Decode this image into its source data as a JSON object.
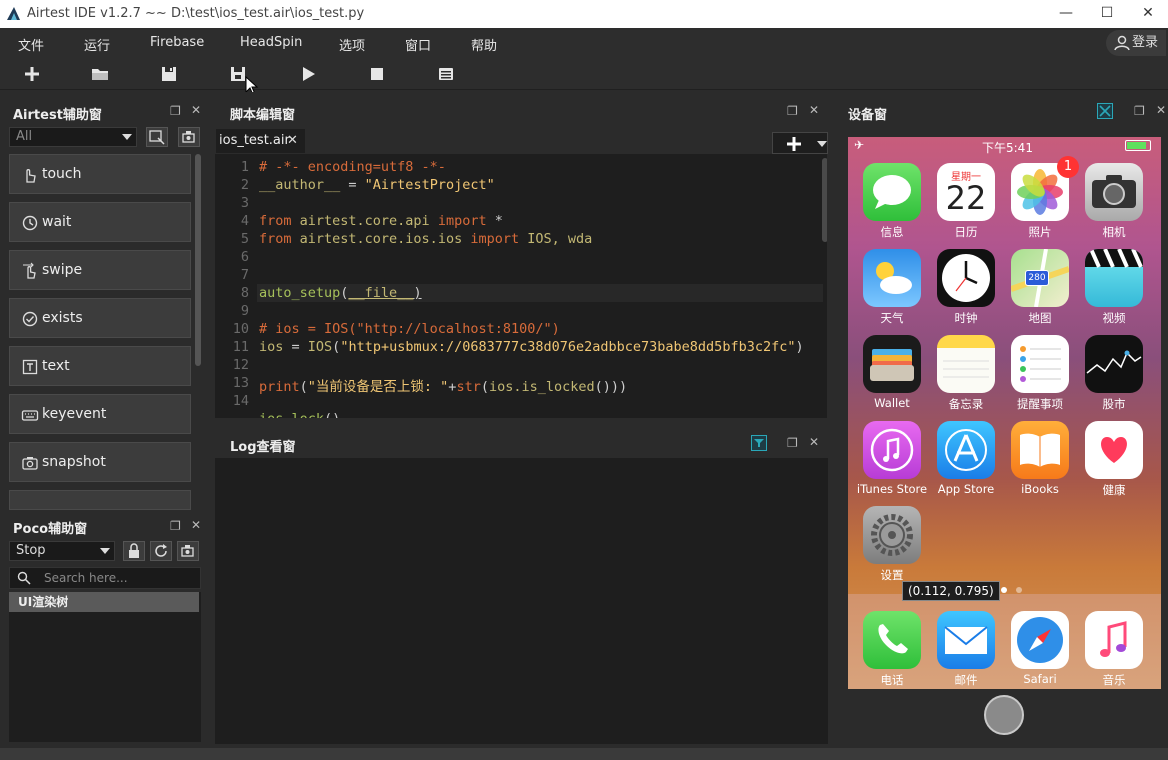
{
  "titlebar": {
    "title": "Airtest IDE v1.2.7 ~~ D:\\test\\ios_test.air\\ios_test.py"
  },
  "menu": {
    "items": [
      "文件",
      "运行",
      "Firebase",
      "HeadSpin",
      "选项",
      "窗口",
      "帮助"
    ],
    "login_label": "登录"
  },
  "airtest_panel": {
    "title": "Airtest辅助窗",
    "filter_value": "All",
    "apis": [
      "touch",
      "wait",
      "swipe",
      "exists",
      "text",
      "keyevent",
      "snapshot"
    ]
  },
  "poco_panel": {
    "title": "Poco辅助窗",
    "mode_value": "Stop",
    "search_placeholder": "Search here...",
    "tree_root": "UI渲染树"
  },
  "editor": {
    "title": "脚本编辑窗",
    "tab_label": "ios_test.air",
    "line_numbers": [
      "1",
      "2",
      "3",
      "4",
      "5",
      "6",
      "7",
      "8",
      "9",
      "10",
      "11",
      "12",
      "13",
      "14"
    ]
  },
  "log_panel": {
    "title": "Log查看窗"
  },
  "device_panel": {
    "title": "设备窗",
    "status_time": "下午5:41",
    "calendar_weekday": "星期一",
    "calendar_day": "22",
    "photos_badge": "1",
    "apps": [
      "信息",
      "日历",
      "照片",
      "相机",
      "天气",
      "时钟",
      "地图",
      "视频",
      "Wallet",
      "备忘录",
      "提醒事项",
      "股市",
      "iTunes Store",
      "App Store",
      "iBooks",
      "健康",
      "设置"
    ],
    "dock_apps": [
      "电话",
      "邮件",
      "Safari",
      "音乐"
    ],
    "maps_shield": "280",
    "coord_tooltip": "(0.112, 0.795)"
  },
  "colors": {
    "accent_teal": "#2aa7b8",
    "code_keyword": "#d86b3a",
    "code_string": "#f0c674",
    "code_func": "#a6c05a"
  }
}
